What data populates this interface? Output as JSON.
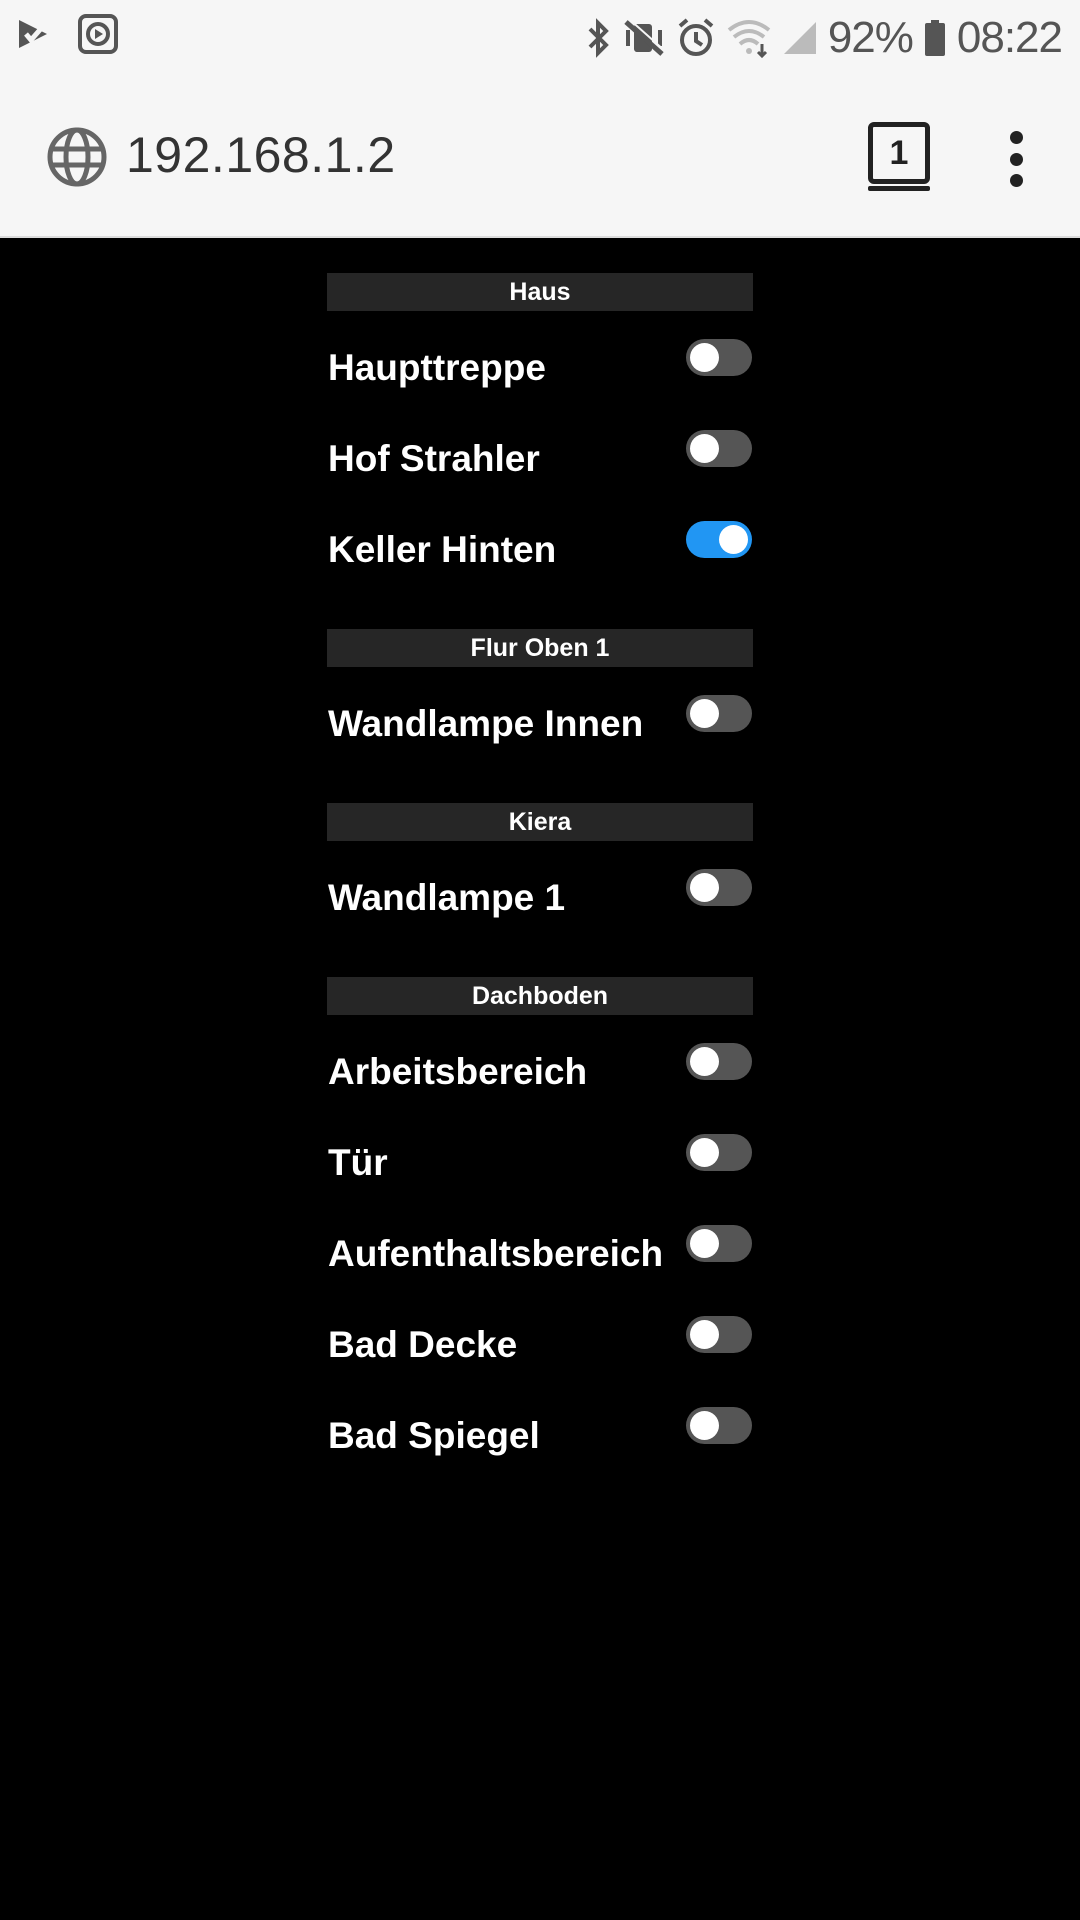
{
  "status_bar": {
    "battery_percent": "92%",
    "time": "08:22",
    "icons": [
      "check-notification-icon",
      "media-notification-icon",
      "bluetooth-icon",
      "vibrate-mute-icon",
      "alarm-icon",
      "wifi-icon",
      "signal-icon",
      "battery-icon"
    ]
  },
  "browser": {
    "url": "192.168.1.2",
    "tab_count": "1"
  },
  "sections": [
    {
      "title": "Haus",
      "items": [
        {
          "label": "Haupttreppe",
          "on": false
        },
        {
          "label": "Hof Strahler",
          "on": false
        },
        {
          "label": "Keller Hinten",
          "on": true
        }
      ]
    },
    {
      "title": "Flur Oben 1",
      "items": [
        {
          "label": "Wandlampe Innen",
          "on": false
        }
      ]
    },
    {
      "title": "Kiera",
      "items": [
        {
          "label": "Wandlampe 1",
          "on": false
        }
      ]
    },
    {
      "title": "Dachboden",
      "items": [
        {
          "label": "Arbeitsbereich",
          "on": false
        },
        {
          "label": "Tür",
          "on": false
        },
        {
          "label": "Aufenthaltsbereich",
          "on": false
        },
        {
          "label": "Bad Decke",
          "on": false
        },
        {
          "label": "Bad Spiegel",
          "on": false
        }
      ]
    }
  ],
  "colors": {
    "toggle_on": "#2196f3",
    "toggle_off": "#555555",
    "header_bg": "#262626"
  }
}
